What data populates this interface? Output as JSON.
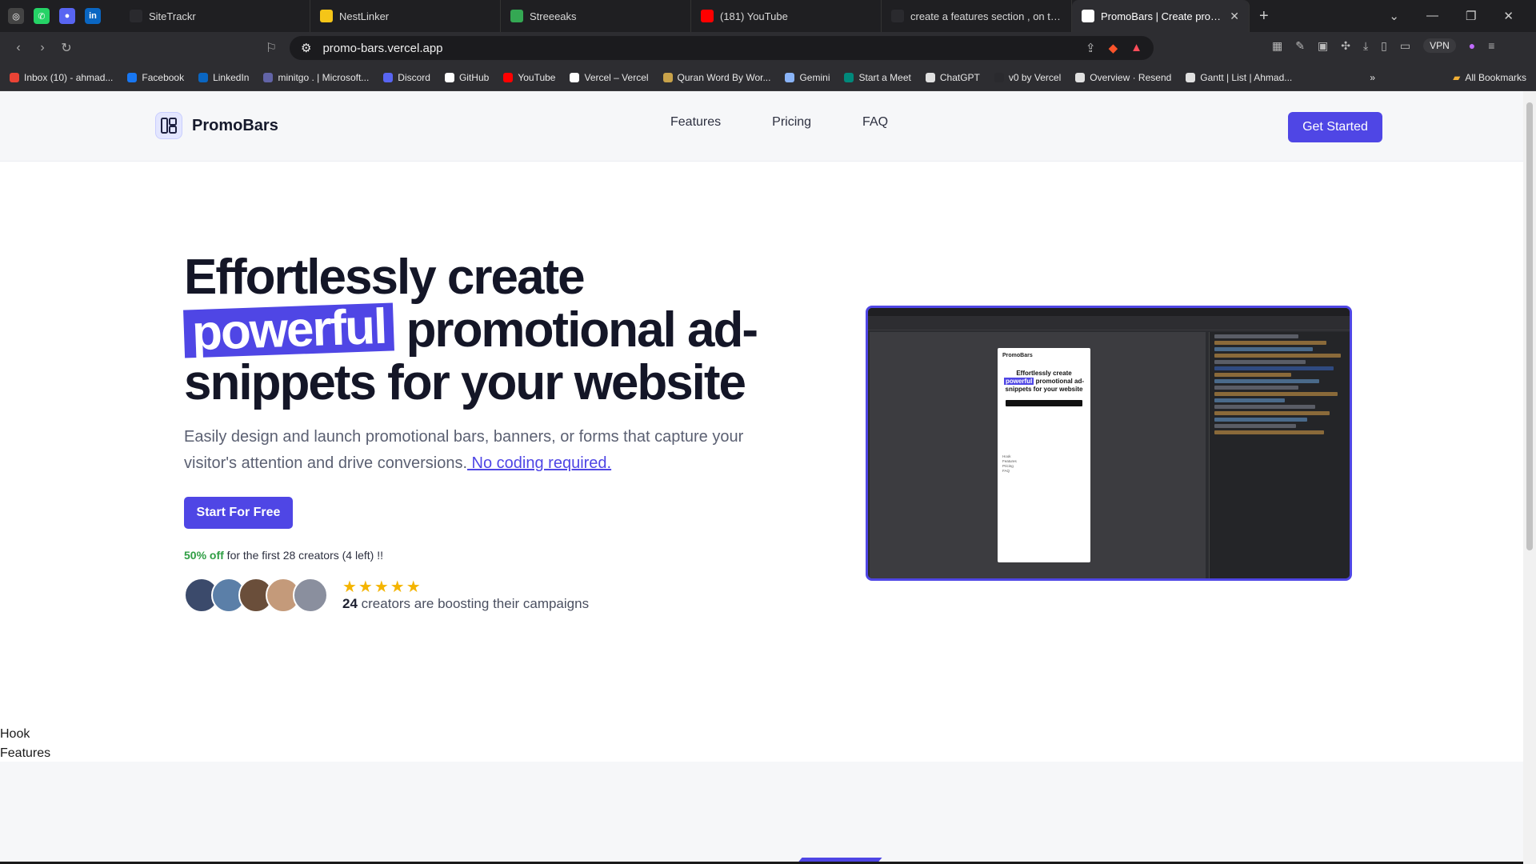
{
  "browser": {
    "tabs": [
      {
        "label": "SiteTrackr",
        "color": "#2a2a2e"
      },
      {
        "label": "NestLinker",
        "color": "#f5c518"
      },
      {
        "label": "Streeeaks",
        "color": "#34a853"
      },
      {
        "label": "(181) YouTube",
        "color": "#ff0000"
      },
      {
        "label": "create a features section , on the top",
        "color": "#2a2a2e"
      },
      {
        "label": "PromoBars | Create promotional",
        "color": "#ffffff"
      }
    ],
    "url": "promo-bars.vercel.app",
    "vpn_label": "VPN",
    "bookmarks": [
      {
        "label": "Inbox (10) - ahmad...",
        "color": "#ea4335"
      },
      {
        "label": "Facebook",
        "color": "#1877f2"
      },
      {
        "label": "LinkedIn",
        "color": "#0a66c2"
      },
      {
        "label": "minitgo . | Microsoft...",
        "color": "#6264a7"
      },
      {
        "label": "Discord",
        "color": "#5865f2"
      },
      {
        "label": "GitHub",
        "color": "#ffffff"
      },
      {
        "label": "YouTube",
        "color": "#ff0000"
      },
      {
        "label": "Vercel – Vercel",
        "color": "#ffffff"
      },
      {
        "label": "Quran Word By Wor...",
        "color": "#c8a24a"
      },
      {
        "label": "Gemini",
        "color": "#8ab4f8"
      },
      {
        "label": "Start a Meet",
        "color": "#00897b"
      },
      {
        "label": "ChatGPT",
        "color": "#e0e0e0"
      },
      {
        "label": "v0 by Vercel",
        "color": "#2a2a2e"
      },
      {
        "label": "Overview · Resend",
        "color": "#e0e0e0"
      },
      {
        "label": "Gantt | List | Ahmad...",
        "color": "#e0e0e0"
      }
    ],
    "all_bookmarks": "All Bookmarks"
  },
  "site": {
    "brand": "PromoBars",
    "nav": [
      "Features",
      "Pricing",
      "FAQ"
    ],
    "cta": "Get Started",
    "hero": {
      "title_1": "Effortlessly create",
      "highlight": "powerful",
      "title_2": "promotional ad-snippets for your website",
      "subtitle": "Easily design and launch promotional bars, banners, or forms that capture your visitor's attention and drive conversions.",
      "subtitle_link": " No coding required.",
      "button": "Start For Free",
      "offer_highlight": "50% off",
      "offer_rest": " for the first 28 creators (4 left) !!",
      "stars": "★★★★★",
      "creators_count": "24",
      "creators_text": " creators are boosting their campaigns"
    },
    "avatars": [
      "#3b4a6b",
      "#5b7fa8",
      "#6a4e3a",
      "#c49a7a",
      "#8a8f9e"
    ],
    "section_links": [
      "Hook",
      "Features"
    ],
    "accent": "#4f46e5"
  },
  "preview": {
    "brand": "PromoBars",
    "title_1": "Effortlessly create",
    "highlight": "powerful",
    "title_2": "promotional ad-snippets for your website",
    "lines": [
      "Hook",
      "Features",
      "Pricing",
      "FAQ"
    ]
  }
}
